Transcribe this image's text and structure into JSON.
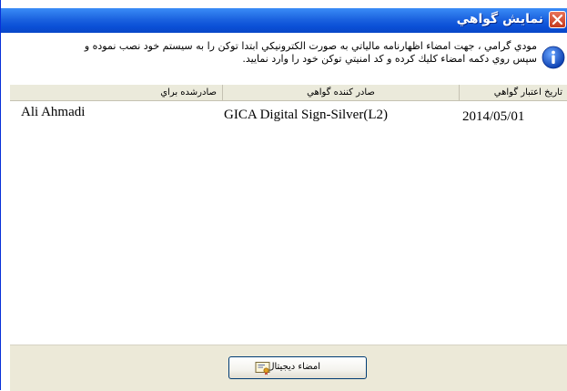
{
  "window": {
    "title": "نمايش گواهي"
  },
  "info": {
    "icon": "info-icon",
    "line1": "مودي گرامي ، جهت امضاء اظهارنامه مالياتي به صورت الكترونيكي ابتدا توكن را به سيستم خود نصب نموده و",
    "line2": "سپس روي دكمه امضاء كليك كرده و كد امنيتي توكن خود را وارد نماييد."
  },
  "table": {
    "headers": {
      "expiry_date": "تاريخ اعتبار گواهي",
      "issuer": "صادر كننده گواهي",
      "issued_for": "صادرشده براي"
    },
    "rows": [
      {
        "issued_for": "Ali Ahmadi",
        "issuer": "GICA Digital Sign-Silver(L2)",
        "expiry_date": "2014/05/01"
      }
    ]
  },
  "footer": {
    "sign_button_label": "امضاء ديجيتال",
    "sign_button_icon": "certificate-sign-icon"
  },
  "colors": {
    "titlebar": "#1c63e0",
    "close_button": "#d8522e",
    "footer_bg": "#ece9d8",
    "header_bg": "#ebeadb"
  }
}
